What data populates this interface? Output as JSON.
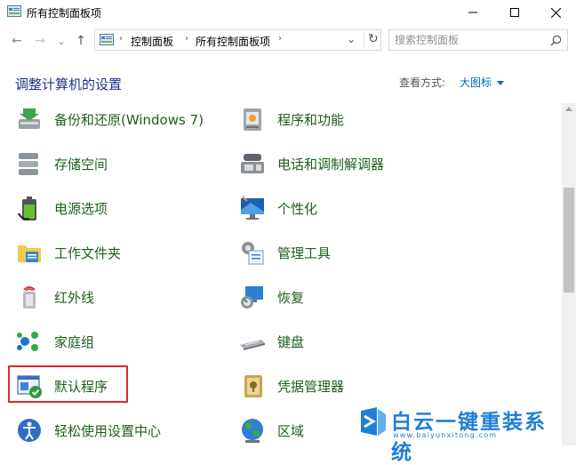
{
  "window": {
    "title": "所有控制面板项",
    "minimize_glyph": "—",
    "maximize_glyph": "☐",
    "close_glyph": "✕"
  },
  "nav": {
    "back_glyph": "←",
    "forward_glyph": "→",
    "recent_glyph": "⌄",
    "up_glyph": "↑",
    "breadcrumb": [
      "控制面板",
      "所有控制面板项"
    ],
    "breadcrumb_sep": "›",
    "refresh_glyph": "↻",
    "search_placeholder": "搜索控制面板"
  },
  "header": {
    "title": "调整计算机的设置",
    "view_by_label": "查看方式:",
    "view_by_value": "大图标"
  },
  "items_left": [
    {
      "label": "备份和还原(Windows 7)",
      "icon": "backup-restore-icon"
    },
    {
      "label": "存储空间",
      "icon": "storage-spaces-icon"
    },
    {
      "label": "电源选项",
      "icon": "power-options-icon"
    },
    {
      "label": "工作文件夹",
      "icon": "work-folders-icon"
    },
    {
      "label": "红外线",
      "icon": "infrared-icon"
    },
    {
      "label": "家庭组",
      "icon": "homegroup-icon"
    },
    {
      "label": "默认程序",
      "icon": "default-programs-icon"
    },
    {
      "label": "轻松使用设置中心",
      "icon": "ease-of-access-icon"
    }
  ],
  "items_right": [
    {
      "label": "程序和功能",
      "icon": "programs-features-icon"
    },
    {
      "label": "电话和调制解调器",
      "icon": "phone-modem-icon"
    },
    {
      "label": "个性化",
      "icon": "personalization-icon"
    },
    {
      "label": "管理工具",
      "icon": "admin-tools-icon"
    },
    {
      "label": "恢复",
      "icon": "recovery-icon"
    },
    {
      "label": "键盘",
      "icon": "keyboard-icon"
    },
    {
      "label": "凭据管理器",
      "icon": "credential-manager-icon"
    },
    {
      "label": "区域",
      "icon": "region-icon"
    }
  ],
  "watermark": {
    "text": "白云一键重装系统",
    "url": "www.baiyunxitong.com"
  },
  "colors": {
    "item_text": "#1e5f1e",
    "title_text": "#1e3287",
    "link_blue": "#0066cc",
    "highlight_border": "#e0262a",
    "watermark_blue": "#1f7fd3"
  }
}
